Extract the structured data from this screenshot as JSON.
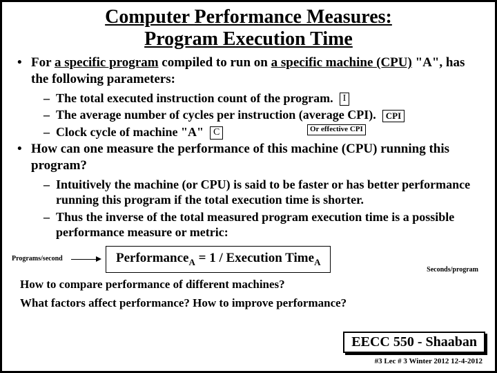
{
  "title_line1": "Computer Performance Measures:",
  "title_line2": "Program Execution Time",
  "bullets": {
    "b1_pre": "For ",
    "b1_u1": "a specific program",
    "b1_mid": " compiled to run on ",
    "b1_u2": "a specific machine (CPU)",
    "b1_post": " \"A\", has the following parameters:",
    "s1": "The total executed instruction count of the program.",
    "s1_box": "I",
    "s2": "The average number of cycles per instruction (average CPI).",
    "s2_annot": "CPI",
    "s3": "Clock cycle of machine \"A\"",
    "s3_box": "C",
    "eff_label": "Or effective CPI",
    "b2": "How can one measure the performance of this machine (CPU) running this program?",
    "s4": "Intuitively the machine (or CPU) is said to be faster or has better performance running this program if the total execution time is shorter.",
    "s5": "Thus the inverse of the total measured program execution time is a possible performance measure or metric:"
  },
  "labels": {
    "programs_per_second": "Programs/second",
    "seconds_per_program": "Seconds/program"
  },
  "formula": {
    "perf": "Performance",
    "subA": "A",
    "eq": "  =  1 /  ",
    "exec": "Execution Time",
    "subA2": "A"
  },
  "questions": {
    "q1": "How to compare performance of different machines?",
    "q2": "What factors affect performance?  How to improve performance?"
  },
  "footer": {
    "course": "EECC 550 - Shaaban",
    "meta": "#3  Lec # 3   Winter 2012  12-4-2012"
  }
}
